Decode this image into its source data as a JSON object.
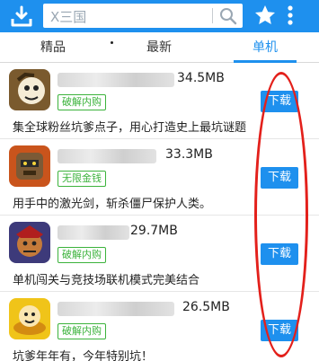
{
  "search": {
    "placeholder": "X三国"
  },
  "tabs": [
    {
      "label": "精品"
    },
    {
      "label": "最新"
    },
    {
      "label": "单机"
    }
  ],
  "apps": [
    {
      "size": "34.5MB",
      "badge": "破解内购",
      "description": "集全球粉丝坑爹点子，用心打造史上最坑谜题",
      "download_label": "下载",
      "icon": "cartoon-face-icon"
    },
    {
      "size": "33.3MB",
      "badge": "无限金钱",
      "description": "用手中的激光剑，斩杀僵尸保护人类。",
      "download_label": "下载",
      "icon": "robot-warrior-icon"
    },
    {
      "size": "29.7MB",
      "badge": "破解内购",
      "description": "单机闯关与竞技场联机模式完美结合",
      "download_label": "下载",
      "icon": "armored-warrior-icon"
    },
    {
      "size": "26.5MB",
      "badge": "破解内购",
      "description": "坑爹年年有，今年特别坑！",
      "download_label": "下载",
      "icon": "gold-ingot-character-icon"
    }
  ],
  "colors": {
    "accent": "#1e90ee",
    "badge_green": "#3cb33c",
    "annotation_red": "#e3201b"
  }
}
